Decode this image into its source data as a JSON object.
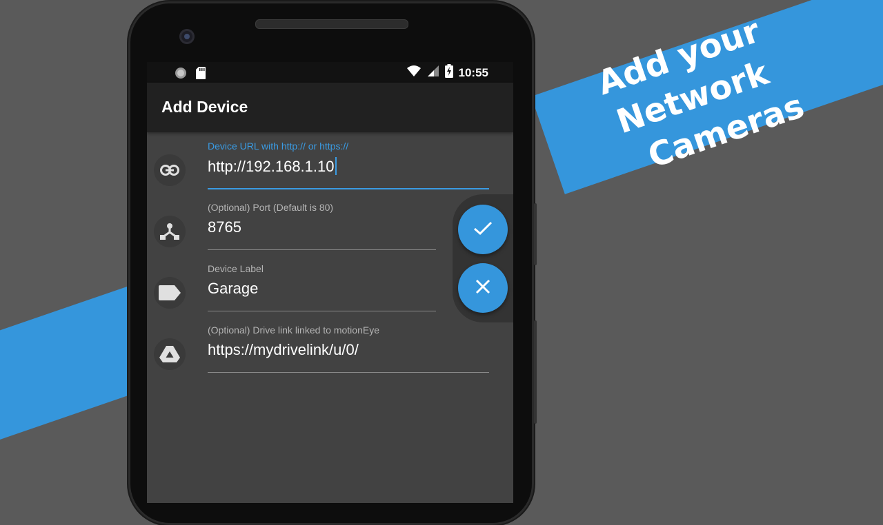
{
  "promo": {
    "line1": "Add your Network",
    "line2": "Cameras"
  },
  "statusbar": {
    "time": "10:55",
    "icons": [
      "sync-icon",
      "sd-card-icon",
      "wifi-icon",
      "signal-icon",
      "battery-charging-icon"
    ]
  },
  "appbar": {
    "title": "Add Device"
  },
  "form": {
    "url": {
      "label": "Device URL with http:// or https://",
      "value": "http://192.168.1.10",
      "icon": "link-icon"
    },
    "port": {
      "label": "(Optional) Port (Default is 80)",
      "value": "8765",
      "icon": "network-icon"
    },
    "device_label": {
      "label": "Device Label",
      "value": "Garage",
      "icon": "label-icon"
    },
    "drive": {
      "label": "(Optional) Drive link linked to motionEye",
      "value": "https://mydrivelink/u/0/",
      "icon": "drive-icon"
    }
  },
  "actions": {
    "confirm_icon": "check-icon",
    "cancel_icon": "close-icon"
  },
  "colors": {
    "accent": "#3596dc",
    "background": "#5a5a5a",
    "screen": "#424242",
    "appbar": "#212121"
  }
}
